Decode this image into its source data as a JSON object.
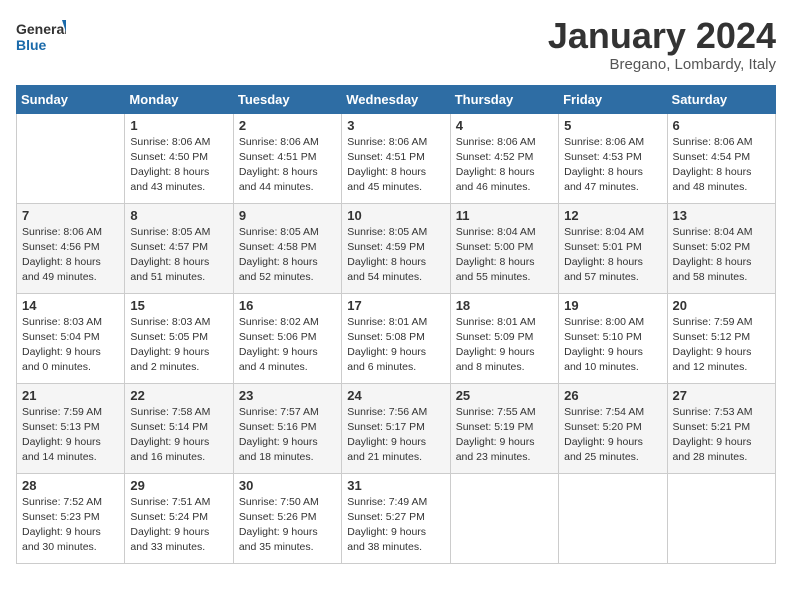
{
  "header": {
    "logo_general": "General",
    "logo_blue": "Blue",
    "month_title": "January 2024",
    "location": "Bregano, Lombardy, Italy"
  },
  "weekdays": [
    "Sunday",
    "Monday",
    "Tuesday",
    "Wednesday",
    "Thursday",
    "Friday",
    "Saturday"
  ],
  "weeks": [
    [
      {
        "day": "",
        "sunrise": "",
        "sunset": "",
        "daylight": ""
      },
      {
        "day": "1",
        "sunrise": "Sunrise: 8:06 AM",
        "sunset": "Sunset: 4:50 PM",
        "daylight": "Daylight: 8 hours and 43 minutes."
      },
      {
        "day": "2",
        "sunrise": "Sunrise: 8:06 AM",
        "sunset": "Sunset: 4:51 PM",
        "daylight": "Daylight: 8 hours and 44 minutes."
      },
      {
        "day": "3",
        "sunrise": "Sunrise: 8:06 AM",
        "sunset": "Sunset: 4:51 PM",
        "daylight": "Daylight: 8 hours and 45 minutes."
      },
      {
        "day": "4",
        "sunrise": "Sunrise: 8:06 AM",
        "sunset": "Sunset: 4:52 PM",
        "daylight": "Daylight: 8 hours and 46 minutes."
      },
      {
        "day": "5",
        "sunrise": "Sunrise: 8:06 AM",
        "sunset": "Sunset: 4:53 PM",
        "daylight": "Daylight: 8 hours and 47 minutes."
      },
      {
        "day": "6",
        "sunrise": "Sunrise: 8:06 AM",
        "sunset": "Sunset: 4:54 PM",
        "daylight": "Daylight: 8 hours and 48 minutes."
      }
    ],
    [
      {
        "day": "7",
        "sunrise": "Sunrise: 8:06 AM",
        "sunset": "Sunset: 4:56 PM",
        "daylight": "Daylight: 8 hours and 49 minutes."
      },
      {
        "day": "8",
        "sunrise": "Sunrise: 8:05 AM",
        "sunset": "Sunset: 4:57 PM",
        "daylight": "Daylight: 8 hours and 51 minutes."
      },
      {
        "day": "9",
        "sunrise": "Sunrise: 8:05 AM",
        "sunset": "Sunset: 4:58 PM",
        "daylight": "Daylight: 8 hours and 52 minutes."
      },
      {
        "day": "10",
        "sunrise": "Sunrise: 8:05 AM",
        "sunset": "Sunset: 4:59 PM",
        "daylight": "Daylight: 8 hours and 54 minutes."
      },
      {
        "day": "11",
        "sunrise": "Sunrise: 8:04 AM",
        "sunset": "Sunset: 5:00 PM",
        "daylight": "Daylight: 8 hours and 55 minutes."
      },
      {
        "day": "12",
        "sunrise": "Sunrise: 8:04 AM",
        "sunset": "Sunset: 5:01 PM",
        "daylight": "Daylight: 8 hours and 57 minutes."
      },
      {
        "day": "13",
        "sunrise": "Sunrise: 8:04 AM",
        "sunset": "Sunset: 5:02 PM",
        "daylight": "Daylight: 8 hours and 58 minutes."
      }
    ],
    [
      {
        "day": "14",
        "sunrise": "Sunrise: 8:03 AM",
        "sunset": "Sunset: 5:04 PM",
        "daylight": "Daylight: 9 hours and 0 minutes."
      },
      {
        "day": "15",
        "sunrise": "Sunrise: 8:03 AM",
        "sunset": "Sunset: 5:05 PM",
        "daylight": "Daylight: 9 hours and 2 minutes."
      },
      {
        "day": "16",
        "sunrise": "Sunrise: 8:02 AM",
        "sunset": "Sunset: 5:06 PM",
        "daylight": "Daylight: 9 hours and 4 minutes."
      },
      {
        "day": "17",
        "sunrise": "Sunrise: 8:01 AM",
        "sunset": "Sunset: 5:08 PM",
        "daylight": "Daylight: 9 hours and 6 minutes."
      },
      {
        "day": "18",
        "sunrise": "Sunrise: 8:01 AM",
        "sunset": "Sunset: 5:09 PM",
        "daylight": "Daylight: 9 hours and 8 minutes."
      },
      {
        "day": "19",
        "sunrise": "Sunrise: 8:00 AM",
        "sunset": "Sunset: 5:10 PM",
        "daylight": "Daylight: 9 hours and 10 minutes."
      },
      {
        "day": "20",
        "sunrise": "Sunrise: 7:59 AM",
        "sunset": "Sunset: 5:12 PM",
        "daylight": "Daylight: 9 hours and 12 minutes."
      }
    ],
    [
      {
        "day": "21",
        "sunrise": "Sunrise: 7:59 AM",
        "sunset": "Sunset: 5:13 PM",
        "daylight": "Daylight: 9 hours and 14 minutes."
      },
      {
        "day": "22",
        "sunrise": "Sunrise: 7:58 AM",
        "sunset": "Sunset: 5:14 PM",
        "daylight": "Daylight: 9 hours and 16 minutes."
      },
      {
        "day": "23",
        "sunrise": "Sunrise: 7:57 AM",
        "sunset": "Sunset: 5:16 PM",
        "daylight": "Daylight: 9 hours and 18 minutes."
      },
      {
        "day": "24",
        "sunrise": "Sunrise: 7:56 AM",
        "sunset": "Sunset: 5:17 PM",
        "daylight": "Daylight: 9 hours and 21 minutes."
      },
      {
        "day": "25",
        "sunrise": "Sunrise: 7:55 AM",
        "sunset": "Sunset: 5:19 PM",
        "daylight": "Daylight: 9 hours and 23 minutes."
      },
      {
        "day": "26",
        "sunrise": "Sunrise: 7:54 AM",
        "sunset": "Sunset: 5:20 PM",
        "daylight": "Daylight: 9 hours and 25 minutes."
      },
      {
        "day": "27",
        "sunrise": "Sunrise: 7:53 AM",
        "sunset": "Sunset: 5:21 PM",
        "daylight": "Daylight: 9 hours and 28 minutes."
      }
    ],
    [
      {
        "day": "28",
        "sunrise": "Sunrise: 7:52 AM",
        "sunset": "Sunset: 5:23 PM",
        "daylight": "Daylight: 9 hours and 30 minutes."
      },
      {
        "day": "29",
        "sunrise": "Sunrise: 7:51 AM",
        "sunset": "Sunset: 5:24 PM",
        "daylight": "Daylight: 9 hours and 33 minutes."
      },
      {
        "day": "30",
        "sunrise": "Sunrise: 7:50 AM",
        "sunset": "Sunset: 5:26 PM",
        "daylight": "Daylight: 9 hours and 35 minutes."
      },
      {
        "day": "31",
        "sunrise": "Sunrise: 7:49 AM",
        "sunset": "Sunset: 5:27 PM",
        "daylight": "Daylight: 9 hours and 38 minutes."
      },
      {
        "day": "",
        "sunrise": "",
        "sunset": "",
        "daylight": ""
      },
      {
        "day": "",
        "sunrise": "",
        "sunset": "",
        "daylight": ""
      },
      {
        "day": "",
        "sunrise": "",
        "sunset": "",
        "daylight": ""
      }
    ]
  ]
}
